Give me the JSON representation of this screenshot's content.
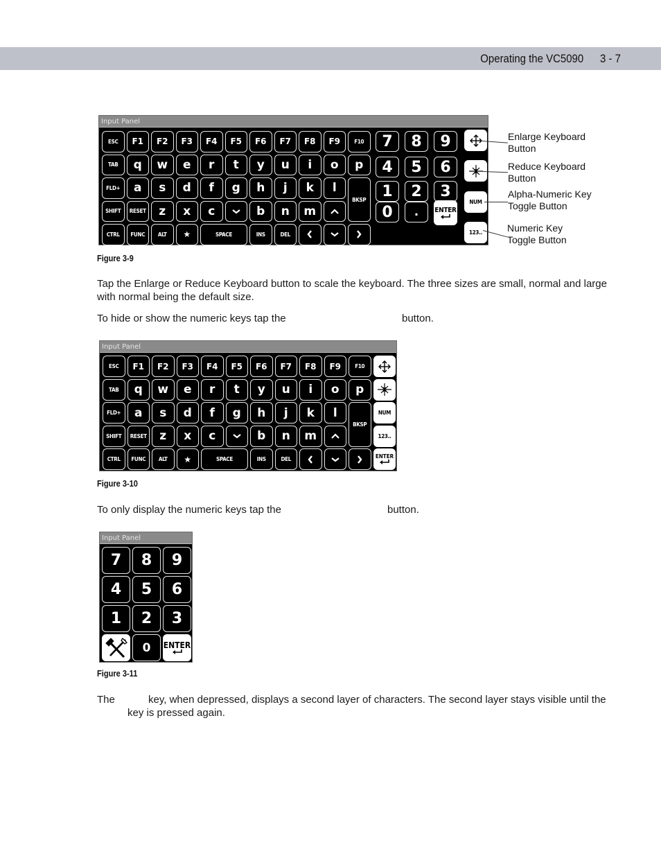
{
  "header": {
    "title": "Operating the VC5090",
    "page": "3 - 7"
  },
  "figure1": {
    "panel_title": "Input Panel",
    "caption": "Figure 3-9",
    "rows": [
      [
        "ESC",
        "F1",
        "F2",
        "F3",
        "F4",
        "F5",
        "F6",
        "F7",
        "F8",
        "F9",
        "F10"
      ],
      [
        "TAB",
        "q",
        "w",
        "e",
        "r",
        "t",
        "y",
        "u",
        "i",
        "o",
        "p"
      ],
      [
        "FLD+",
        "a",
        "s",
        "d",
        "f",
        "g",
        "h",
        "j",
        "k",
        "l",
        "BKSP"
      ],
      [
        "SHIFT",
        "RESET",
        "z",
        "x",
        "c",
        "v",
        "b",
        "n",
        "m",
        "^"
      ],
      [
        "CTRL",
        "FUNC",
        "ALT",
        "★",
        "SPACE",
        "INS",
        "DEL",
        "<",
        "v",
        ">"
      ]
    ],
    "numpad": [
      "7",
      "8",
      "9",
      "4",
      "5",
      "6",
      "1",
      "2",
      "3",
      "0",
      "."
    ],
    "enter_label": "ENTER",
    "side_buttons": {
      "enlarge_icon": "enlarge-arrows-icon",
      "reduce_icon": "reduce-star-icon",
      "num_label": "NUM",
      "numeric_label": "123.."
    },
    "callouts": [
      {
        "line1": "Enlarge Keyboard",
        "line2": "Button"
      },
      {
        "line1": "Reduce Keyboard",
        "line2": "Button"
      },
      {
        "line1": "Alpha-Numeric Key",
        "line2": "Toggle Button"
      },
      {
        "line1": "Numeric Key",
        "line2": "Toggle Button"
      }
    ]
  },
  "paragraphs": {
    "p1_line1": "Tap the Enlarge or Reduce Keyboard button to scale the keyboard. The three sizes are small, normal and large",
    "p1_line2": "with normal being the default size.",
    "p2_before": "To hide or show the numeric keys tap the",
    "p2_after": "button.",
    "p3_before": "To only display the numeric keys tap the",
    "p3_after": "button.",
    "p4_before": "The",
    "p4_after": "key, when depressed, displays a second layer of characters. The second layer stays visible until the",
    "p4_line2": "key is pressed again."
  },
  "figure2": {
    "panel_title": "Input Panel",
    "caption": "Figure 3-10",
    "side_labels": {
      "num_label": "NUM",
      "numeric_label": "123..",
      "enter_label": "ENTER"
    }
  },
  "figure3": {
    "panel_title": "Input Panel",
    "caption": "Figure 3-11",
    "keys": [
      "7",
      "8",
      "9",
      "4",
      "5",
      "6",
      "1",
      "2",
      "3",
      "0"
    ],
    "tools_icon": "hammer-screwdriver-icon",
    "enter_label": "ENTER"
  }
}
